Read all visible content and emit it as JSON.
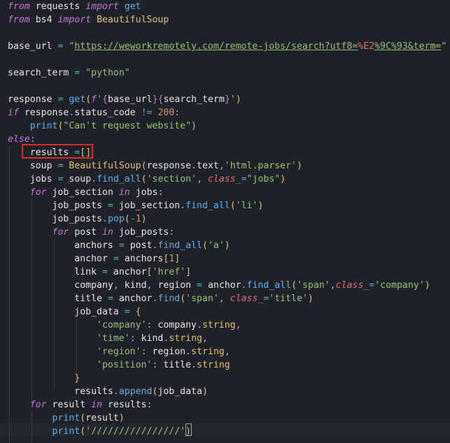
{
  "editor": {
    "theme_colors": {
      "background": "#1e2127",
      "keyword": "#c678dd",
      "string": "#98c379",
      "function": "#61afef",
      "class": "#e5c07b",
      "number": "#d19a66",
      "operator": "#56b6c2",
      "highlight_box": "#e02a2a"
    },
    "lines": [
      [
        [
          "kw",
          "from"
        ],
        [
          "sp",
          " "
        ],
        [
          "ident",
          "requests"
        ],
        [
          "sp",
          " "
        ],
        [
          "kw",
          "import"
        ],
        [
          "sp",
          " "
        ],
        [
          "fn",
          "get"
        ]
      ],
      [
        [
          "kw",
          "from"
        ],
        [
          "sp",
          " "
        ],
        [
          "ident",
          "bs4"
        ],
        [
          "sp",
          " "
        ],
        [
          "kw",
          "import"
        ],
        [
          "sp",
          " "
        ],
        [
          "cls",
          "BeautifulSoup"
        ]
      ],
      [],
      [
        [
          "ident",
          "base_url"
        ],
        [
          "sp",
          " "
        ],
        [
          "op",
          "="
        ],
        [
          "sp",
          " "
        ],
        [
          "str",
          "\""
        ],
        [
          "str-url",
          "https://weworkremotely.com/remote-jobs/search?utf8="
        ],
        [
          "str-esc",
          "%E2"
        ],
        [
          "str-url",
          "%9C%93&term="
        ],
        [
          "str",
          "\""
        ]
      ],
      [],
      [
        [
          "ident",
          "search_term"
        ],
        [
          "sp",
          " "
        ],
        [
          "op",
          "="
        ],
        [
          "sp",
          " "
        ],
        [
          "str",
          "\"python\""
        ]
      ],
      [],
      [
        [
          "ident",
          "response"
        ],
        [
          "sp",
          " "
        ],
        [
          "op",
          "="
        ],
        [
          "sp",
          " "
        ],
        [
          "fn",
          "get"
        ],
        [
          "bracket-yellow",
          "("
        ],
        [
          "kw",
          "f"
        ],
        [
          "str",
          "'"
        ],
        [
          "bracket-pink",
          "{"
        ],
        [
          "ident",
          "base_url"
        ],
        [
          "bracket-pink",
          "}"
        ],
        [
          "bracket-pink",
          "{"
        ],
        [
          "ident",
          "search_term"
        ],
        [
          "bracket-pink",
          "}"
        ],
        [
          "str",
          "'"
        ],
        [
          "bracket-yellow",
          ")"
        ]
      ],
      [
        [
          "kw",
          "if"
        ],
        [
          "sp",
          " "
        ],
        [
          "ident",
          "response"
        ],
        [
          "punc",
          "."
        ],
        [
          "ident",
          "status_code"
        ],
        [
          "sp",
          " "
        ],
        [
          "op",
          "!="
        ],
        [
          "sp",
          " "
        ],
        [
          "num",
          "200"
        ],
        [
          "punc",
          ":"
        ]
      ],
      [
        [
          "sp",
          "    "
        ],
        [
          "fn",
          "print"
        ],
        [
          "bracket-yellow",
          "("
        ],
        [
          "str",
          "\"Can't request website\""
        ],
        [
          "bracket-yellow",
          ")"
        ]
      ],
      [
        [
          "kw",
          "else"
        ],
        [
          "punc",
          ":"
        ]
      ],
      [
        [
          "sp",
          "    "
        ],
        [
          "ident",
          "results"
        ],
        [
          "sp",
          " "
        ],
        [
          "op",
          "="
        ],
        [
          "bracket-yellow",
          "[]"
        ]
      ],
      [
        [
          "sp",
          "    "
        ],
        [
          "ident",
          "soup"
        ],
        [
          "sp",
          " "
        ],
        [
          "op",
          "="
        ],
        [
          "sp",
          " "
        ],
        [
          "cls",
          "BeautifulSoup"
        ],
        [
          "bracket-yellow",
          "("
        ],
        [
          "ident",
          "response"
        ],
        [
          "punc",
          "."
        ],
        [
          "ident",
          "text"
        ],
        [
          "punc",
          ","
        ],
        [
          "str",
          "'html.parser'"
        ],
        [
          "bracket-yellow",
          ")"
        ]
      ],
      [
        [
          "sp",
          "    "
        ],
        [
          "ident",
          "jobs"
        ],
        [
          "sp",
          " "
        ],
        [
          "op",
          "="
        ],
        [
          "sp",
          " "
        ],
        [
          "ident",
          "soup"
        ],
        [
          "punc",
          "."
        ],
        [
          "fn",
          "find_all"
        ],
        [
          "bracket-yellow",
          "("
        ],
        [
          "str",
          "'section'"
        ],
        [
          "punc",
          ","
        ],
        [
          "sp",
          " "
        ],
        [
          "arg",
          "class_"
        ],
        [
          "op",
          "="
        ],
        [
          "str",
          "\"jobs\""
        ],
        [
          "bracket-yellow",
          ")"
        ]
      ],
      [
        [
          "sp",
          "    "
        ],
        [
          "kw",
          "for"
        ],
        [
          "sp",
          " "
        ],
        [
          "ident",
          "job_section"
        ],
        [
          "sp",
          " "
        ],
        [
          "kw",
          "in"
        ],
        [
          "sp",
          " "
        ],
        [
          "ident",
          "jobs"
        ],
        [
          "punc",
          ":"
        ]
      ],
      [
        [
          "sp",
          "        "
        ],
        [
          "ident",
          "job_posts"
        ],
        [
          "sp",
          " "
        ],
        [
          "op",
          "="
        ],
        [
          "sp",
          " "
        ],
        [
          "ident",
          "job_section"
        ],
        [
          "punc",
          "."
        ],
        [
          "fn",
          "find_all"
        ],
        [
          "bracket-yellow",
          "("
        ],
        [
          "str",
          "'li'"
        ],
        [
          "bracket-yellow",
          ")"
        ]
      ],
      [
        [
          "sp",
          "        "
        ],
        [
          "ident",
          "job_posts"
        ],
        [
          "punc",
          "."
        ],
        [
          "fn",
          "pop"
        ],
        [
          "bracket-yellow",
          "("
        ],
        [
          "op",
          "-"
        ],
        [
          "num",
          "1"
        ],
        [
          "bracket-yellow",
          ")"
        ]
      ],
      [
        [
          "sp",
          "        "
        ],
        [
          "kw",
          "for"
        ],
        [
          "sp",
          " "
        ],
        [
          "ident",
          "post"
        ],
        [
          "sp",
          " "
        ],
        [
          "kw",
          "in"
        ],
        [
          "sp",
          " "
        ],
        [
          "ident",
          "job_posts"
        ],
        [
          "punc",
          ":"
        ]
      ],
      [
        [
          "sp",
          "            "
        ],
        [
          "ident",
          "anchors"
        ],
        [
          "sp",
          " "
        ],
        [
          "op",
          "="
        ],
        [
          "sp",
          " "
        ],
        [
          "ident",
          "post"
        ],
        [
          "punc",
          "."
        ],
        [
          "fn",
          "find_all"
        ],
        [
          "bracket-yellow",
          "("
        ],
        [
          "str",
          "'a'"
        ],
        [
          "bracket-yellow",
          ")"
        ]
      ],
      [
        [
          "sp",
          "            "
        ],
        [
          "ident",
          "anchor"
        ],
        [
          "sp",
          " "
        ],
        [
          "op",
          "="
        ],
        [
          "sp",
          " "
        ],
        [
          "ident",
          "anchors"
        ],
        [
          "bracket-yellow",
          "["
        ],
        [
          "num",
          "1"
        ],
        [
          "bracket-yellow",
          "]"
        ]
      ],
      [
        [
          "sp",
          "            "
        ],
        [
          "ident",
          "link"
        ],
        [
          "sp",
          " "
        ],
        [
          "op",
          "="
        ],
        [
          "sp",
          " "
        ],
        [
          "ident",
          "anchor"
        ],
        [
          "bracket-yellow",
          "["
        ],
        [
          "str",
          "'href'"
        ],
        [
          "bracket-yellow",
          "]"
        ]
      ],
      [
        [
          "sp",
          "            "
        ],
        [
          "ident",
          "company"
        ],
        [
          "punc",
          ","
        ],
        [
          "sp",
          " "
        ],
        [
          "ident",
          "kind"
        ],
        [
          "punc",
          ","
        ],
        [
          "sp",
          " "
        ],
        [
          "ident",
          "region"
        ],
        [
          "sp",
          " "
        ],
        [
          "op",
          "="
        ],
        [
          "sp",
          " "
        ],
        [
          "ident",
          "anchor"
        ],
        [
          "punc",
          "."
        ],
        [
          "fn",
          "find_all"
        ],
        [
          "bracket-yellow",
          "("
        ],
        [
          "str",
          "'span'"
        ],
        [
          "punc",
          ","
        ],
        [
          "arg",
          "class_"
        ],
        [
          "op",
          "="
        ],
        [
          "str",
          "'company'"
        ],
        [
          "bracket-yellow",
          ")"
        ]
      ],
      [
        [
          "sp",
          "            "
        ],
        [
          "ident",
          "title"
        ],
        [
          "sp",
          " "
        ],
        [
          "op",
          "="
        ],
        [
          "sp",
          " "
        ],
        [
          "ident",
          "anchor"
        ],
        [
          "punc",
          "."
        ],
        [
          "fn",
          "find"
        ],
        [
          "bracket-yellow",
          "("
        ],
        [
          "str",
          "'span'"
        ],
        [
          "punc",
          ","
        ],
        [
          "sp",
          " "
        ],
        [
          "arg",
          "class_"
        ],
        [
          "op",
          "="
        ],
        [
          "str",
          "'title'"
        ],
        [
          "bracket-yellow",
          ")"
        ]
      ],
      [
        [
          "sp",
          "            "
        ],
        [
          "ident",
          "job_data"
        ],
        [
          "sp",
          " "
        ],
        [
          "op",
          "="
        ],
        [
          "sp",
          " "
        ],
        [
          "bracket-yellow",
          "{"
        ]
      ],
      [
        [
          "sp",
          "                "
        ],
        [
          "str",
          "'company'"
        ],
        [
          "punc",
          ":"
        ],
        [
          "sp",
          " "
        ],
        [
          "ident",
          "company"
        ],
        [
          "punc",
          "."
        ],
        [
          "prop",
          "string"
        ],
        [
          "punc",
          ","
        ]
      ],
      [
        [
          "sp",
          "                "
        ],
        [
          "str",
          "'time'"
        ],
        [
          "punc",
          ":"
        ],
        [
          "sp",
          " "
        ],
        [
          "ident",
          "kind"
        ],
        [
          "punc",
          "."
        ],
        [
          "prop",
          "string"
        ],
        [
          "punc",
          ","
        ]
      ],
      [
        [
          "sp",
          "                "
        ],
        [
          "str",
          "'region'"
        ],
        [
          "punc",
          ":"
        ],
        [
          "sp",
          " "
        ],
        [
          "ident",
          "region"
        ],
        [
          "punc",
          "."
        ],
        [
          "prop",
          "string"
        ],
        [
          "punc",
          ","
        ]
      ],
      [
        [
          "sp",
          "                "
        ],
        [
          "str",
          "'position'"
        ],
        [
          "punc",
          ":"
        ],
        [
          "sp",
          " "
        ],
        [
          "ident",
          "title"
        ],
        [
          "punc",
          "."
        ],
        [
          "prop",
          "string"
        ]
      ],
      [
        [
          "sp",
          "            "
        ],
        [
          "bracket-yellow",
          "}"
        ]
      ],
      [
        [
          "sp",
          "            "
        ],
        [
          "ident",
          "results"
        ],
        [
          "punc",
          "."
        ],
        [
          "fn",
          "append"
        ],
        [
          "bracket-yellow",
          "("
        ],
        [
          "ident",
          "job_data"
        ],
        [
          "bracket-yellow",
          ")"
        ]
      ],
      [
        [
          "sp",
          "    "
        ],
        [
          "kw",
          "for"
        ],
        [
          "sp",
          " "
        ],
        [
          "ident",
          "result"
        ],
        [
          "sp",
          " "
        ],
        [
          "kw",
          "in"
        ],
        [
          "sp",
          " "
        ],
        [
          "ident",
          "results"
        ],
        [
          "punc",
          ":"
        ]
      ],
      [
        [
          "sp",
          "        "
        ],
        [
          "fn",
          "print"
        ],
        [
          "bracket-yellow",
          "("
        ],
        [
          "ident",
          "result"
        ],
        [
          "bracket-yellow",
          ")"
        ]
      ],
      [
        [
          "sp",
          "        "
        ],
        [
          "fn",
          "print"
        ],
        [
          "bracket-yellow",
          "("
        ],
        [
          "str",
          "'////////////////'"
        ],
        [
          "bracket-yellow",
          ")"
        ]
      ]
    ]
  }
}
